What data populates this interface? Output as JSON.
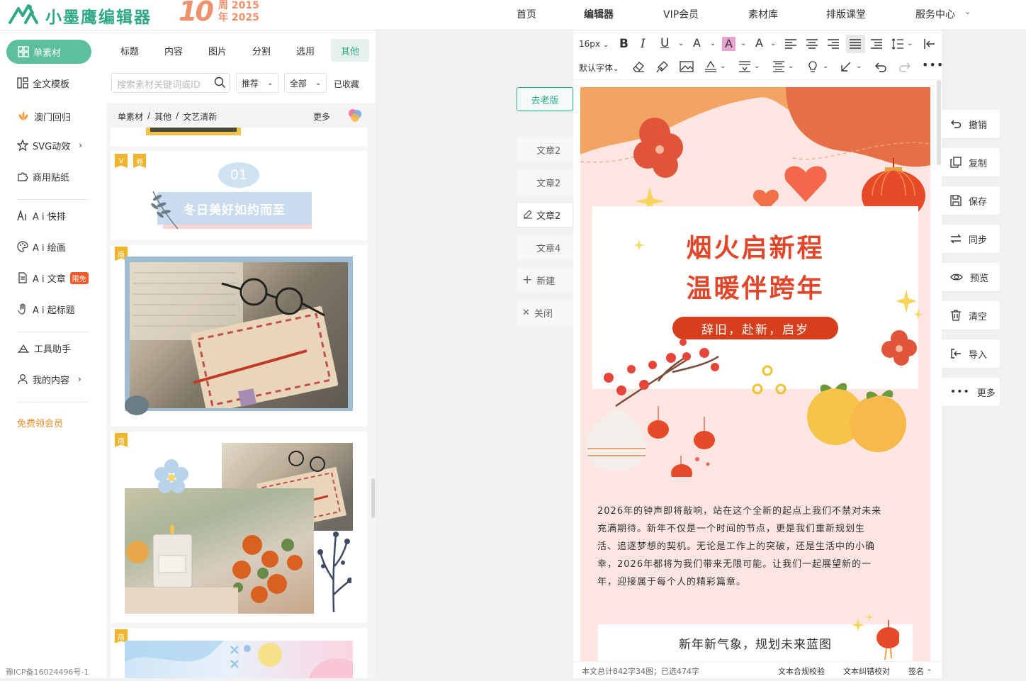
{
  "header": {
    "logo_text": "小墨鹰编辑器",
    "anniv_num": "10",
    "anniv_line1": "周 2015",
    "anniv_line2": "年 2025",
    "nav": [
      "首页",
      "编辑器",
      "VIP会员",
      "素材库",
      "排版课堂",
      "服务中心"
    ]
  },
  "sidebar": {
    "active": "单素材",
    "items": [
      "全文模板",
      "澳门回归",
      "SVG动效",
      "商用贴纸",
      "A i 快排",
      "A i 绘画",
      "A i 文章",
      "A i 起标题",
      "工具助手",
      "我的内容"
    ],
    "limited_badge": "限免",
    "free_member": "免费领会员",
    "icp": "豫ICP备16024496号-1"
  },
  "materials": {
    "tabs": [
      "标题",
      "内容",
      "图片",
      "分割",
      "选用",
      "其他"
    ],
    "search_placeholder": "搜索素材关键词或ID",
    "sort": "推荐",
    "filter": "全部",
    "favorites": "已收藏",
    "breadcrumb": [
      "单素材",
      "其他",
      "文艺清新"
    ],
    "more": "更多",
    "badge_v": "V",
    "badge_shang": "商",
    "card1_number": "01",
    "card1_title": "冬日美好如约而至"
  },
  "docs": {
    "old_version": "去老版",
    "items": [
      "文章2",
      "文章2",
      "文章2",
      "文章4"
    ],
    "new": "新建",
    "close": "关闭"
  },
  "toolbar": {
    "font_size": "16px",
    "font_family": "默认字体"
  },
  "article": {
    "title1": "烟火启新程",
    "title2": "温暖伴跨年",
    "pill": "辞旧，赴新，启岁",
    "body_lines": [
      "2026年的钟声即将敲响，站在这个全新的起点上我们不禁对未来",
      "充满期待。新年不仅是一个时间的节点，更是我们重新规划生",
      "活、追逐梦想的契机。无论是工作上的突破，还是生活中的小确",
      "幸，2026年都将为我们带来无限可能。让我们一起展望新的一",
      "年，迎接属于每个人的精彩篇章。"
    ],
    "sub_title": "新年新气象，规划未来蓝图"
  },
  "status": {
    "stats": "本文总计842字34图；已选474字",
    "compliance": "文本合规校验",
    "proofread": "文本纠错校对",
    "sign": "签名"
  },
  "right_tools": [
    "撤销",
    "复制",
    "保存",
    "同步",
    "预览",
    "清空",
    "导入",
    "更多"
  ],
  "colors": {
    "brand": "#2fa886",
    "accent_red": "#d63e1c",
    "title_red": "#e0462a"
  }
}
